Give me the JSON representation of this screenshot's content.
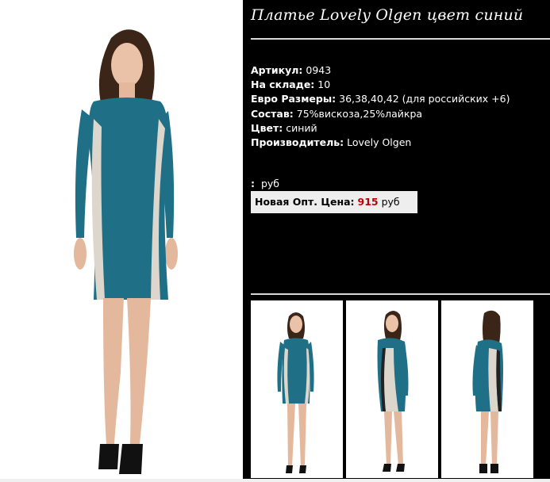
{
  "product": {
    "title": "Платье Lovely Olgen цвет синий",
    "specs": [
      {
        "label": "Артикул:",
        "value": " 0943"
      },
      {
        "label": "На складе:",
        "value": " 10"
      },
      {
        "label": "Евро Размеры:",
        "value": " 36,38,40,42 (для российских +6)"
      },
      {
        "label": "Состав:",
        "value": " 75%вискоза,25%лайкра"
      },
      {
        "label": "Цвет:",
        "value": " синий"
      },
      {
        "label": "Производитель:",
        "value": " Lovely Olgen"
      }
    ],
    "old_price": {
      "label": ":",
      "currency": "руб"
    },
    "new_price": {
      "label": "Новая Опт. Цена:",
      "value": "915",
      "currency": "руб"
    }
  },
  "colors": {
    "dress_teal": "#1f6f86",
    "dress_beige": "#ddd6cc",
    "price_red": "#c00000"
  }
}
